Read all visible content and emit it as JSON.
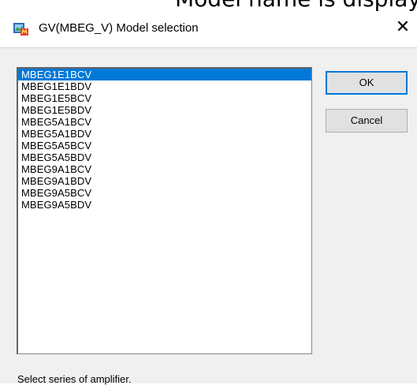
{
  "overlay_caption": "Model name is display",
  "window": {
    "title": "GV(MBEG_V) Model selection",
    "close_glyph": "✕"
  },
  "list": {
    "items": [
      "MBEG1E1BCV",
      "MBEG1E1BDV",
      "MBEG1E5BCV",
      "MBEG1E5BDV",
      "MBEG5A1BCV",
      "MBEG5A1BDV",
      "MBEG5A5BCV",
      "MBEG5A5BDV",
      "MBEG9A1BCV",
      "MBEG9A1BDV",
      "MBEG9A5BCV",
      "MBEG9A5BDV"
    ],
    "selected_index": 0
  },
  "buttons": {
    "ok": "OK",
    "cancel": "Cancel"
  },
  "status_text": "Select  series of amplifier.",
  "colors": {
    "selection": "#0078d7",
    "dialog_bg": "#f0f0f0"
  },
  "icons": {
    "app": "app-icon",
    "close": "close-icon"
  }
}
